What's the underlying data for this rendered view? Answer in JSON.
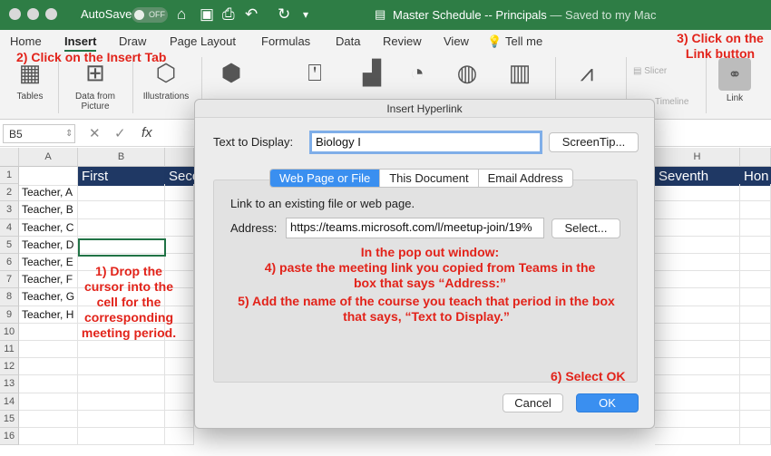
{
  "window": {
    "autosave_label": "AutoSave",
    "toggle_label": "OFF",
    "doc_title": "Master Schedule -- Principals",
    "saved_status": "— Saved to my Mac"
  },
  "ribbon": {
    "tabs": [
      "Home",
      "Insert",
      "Draw",
      "Page Layout",
      "Formulas",
      "Data",
      "Review",
      "View",
      "Tell me"
    ],
    "groups": {
      "tables": "Tables",
      "data_from_picture": "Data from Picture",
      "illustrations": "Illustrations",
      "addins": "Add-ins",
      "slicer": "Slicer",
      "timeline": "Timeline",
      "link": "Link"
    }
  },
  "formula_bar": {
    "name_box": "B5",
    "fx": "fx"
  },
  "sheet": {
    "columns": [
      "A",
      "B",
      "H"
    ],
    "row_numbers": [
      "1",
      "2",
      "3",
      "4",
      "5",
      "6",
      "7",
      "8",
      "9",
      "10",
      "11",
      "12",
      "13",
      "14",
      "15",
      "16"
    ],
    "header_row": {
      "b": "First",
      "c": "Seco",
      "g": "Seventh",
      "h": "Hon"
    },
    "teachers": [
      "Teacher, A",
      "Teacher, B",
      "Teacher, C",
      "Teacher, D",
      "Teacher, E",
      "Teacher, F",
      "Teacher, G",
      "Teacher, H"
    ]
  },
  "dialog": {
    "title": "Insert Hyperlink",
    "text_to_display_label": "Text to Display:",
    "text_to_display_value": "Biology I",
    "screentip_button": "ScreenTip...",
    "tabs": [
      "Web Page or File",
      "This Document",
      "Email Address"
    ],
    "link_hint": "Link to an existing file or web page.",
    "address_label": "Address:",
    "address_value": "https://teams.microsoft.com/l/meetup-join/19%",
    "select_button": "Select...",
    "cancel_button": "Cancel",
    "ok_button": "OK"
  },
  "annotations": {
    "step1": "1) Drop the cursor into the cell for the corresponding meeting period.",
    "step2": "2) Click on the Insert Tab",
    "step3": "3) Click on the Link button",
    "step4_intro": "In the pop out window:",
    "step4": "4) paste the meeting link you copied from Teams in the box that says “Address:”",
    "step5": "5) Add the name of the course you teach that period in the box that says, “Text to Display.”",
    "step6": "6) Select OK"
  },
  "colors": {
    "title_bar": "#2e7d45",
    "header_fill": "#1f3864",
    "annotation": "#e2231a",
    "accent_blue": "#3a8ff0"
  }
}
